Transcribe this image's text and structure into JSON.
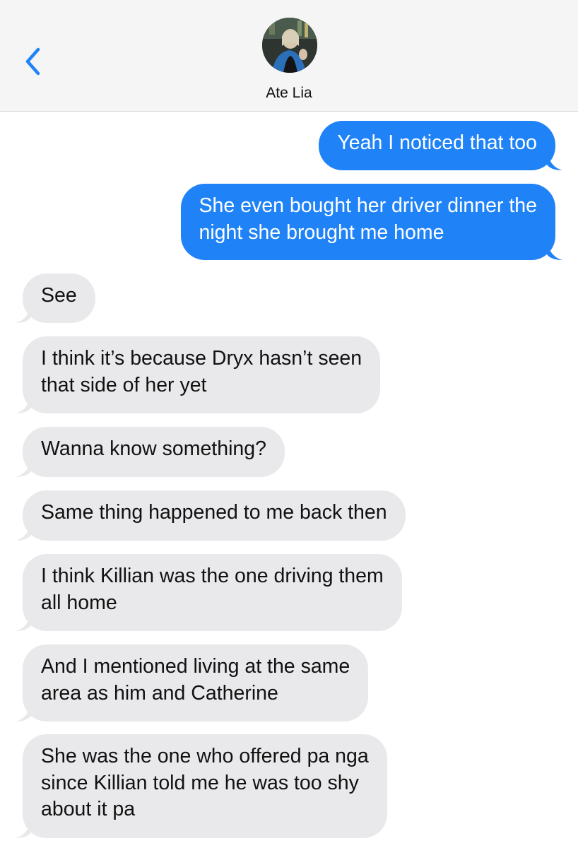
{
  "header": {
    "contact_name": "Ate Lia",
    "back_icon": "chevron-left-icon",
    "accent_color": "#1f83f7"
  },
  "messages": [
    {
      "direction": "sent",
      "lines": [
        "Yeah I noticed that too"
      ]
    },
    {
      "direction": "sent",
      "lines": [
        "She even bought her driver dinner the",
        "night she brought me home"
      ]
    },
    {
      "direction": "received",
      "lines": [
        "See"
      ]
    },
    {
      "direction": "received",
      "lines": [
        "I think it’s because Dryx hasn’t seen",
        "that side of her yet"
      ]
    },
    {
      "direction": "received",
      "lines": [
        "Wanna know something?"
      ]
    },
    {
      "direction": "received",
      "lines": [
        "Same thing happened to me back then"
      ]
    },
    {
      "direction": "received",
      "lines": [
        "I think Killian was the one driving them",
        "all home"
      ]
    },
    {
      "direction": "received",
      "lines": [
        "And I mentioned living at the same",
        "area as him and Catherine"
      ]
    },
    {
      "direction": "received",
      "lines": [
        "She was the one who offered pa nga",
        "since Killian told me he was too shy",
        "about it pa"
      ]
    }
  ],
  "colors": {
    "sent_bubble": "#1f83f7",
    "received_bubble": "#e9e9eb",
    "header_bg": "#f5f5f5"
  }
}
